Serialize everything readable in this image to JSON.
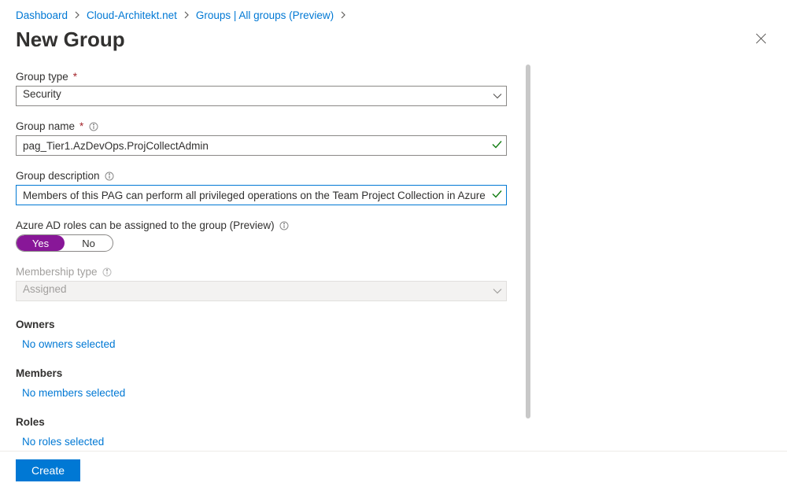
{
  "breadcrumb": {
    "items": [
      {
        "label": "Dashboard"
      },
      {
        "label": "Cloud-Architekt.net"
      },
      {
        "label": "Groups | All groups (Preview)"
      }
    ]
  },
  "page": {
    "title": "New Group"
  },
  "form": {
    "group_type": {
      "label": "Group type",
      "value": "Security"
    },
    "group_name": {
      "label": "Group name",
      "value": "pag_Tier1.AzDevOps.ProjCollectAdmin"
    },
    "group_description": {
      "label": "Group description",
      "value": "Members of this PAG can perform all privileged operations on the Team Project Collection in Azure DevOps"
    },
    "aad_roles": {
      "label": "Azure AD roles can be assigned to the group (Preview)",
      "yes": "Yes",
      "no": "No"
    },
    "membership_type": {
      "label": "Membership type",
      "value": "Assigned"
    },
    "owners": {
      "label": "Owners",
      "link": "No owners selected"
    },
    "members": {
      "label": "Members",
      "link": "No members selected"
    },
    "roles": {
      "label": "Roles",
      "link": "No roles selected"
    }
  },
  "footer": {
    "create": "Create"
  }
}
